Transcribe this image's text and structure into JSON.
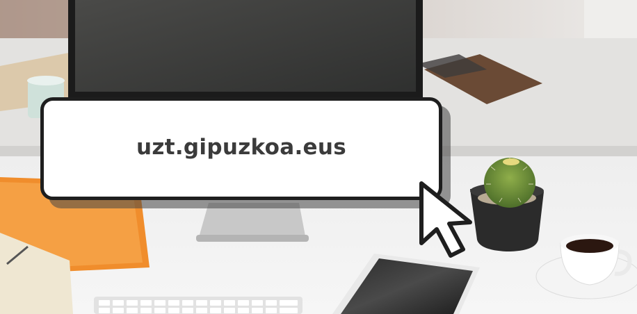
{
  "banner": {
    "url": "uzt.gipuzkoa.eus"
  },
  "colors": {
    "card_border": "#1e1e1e",
    "card_fill": "#ffffff",
    "text": "#3b3b3b"
  },
  "icons": {
    "cursor": "arrow-cursor-icon"
  }
}
